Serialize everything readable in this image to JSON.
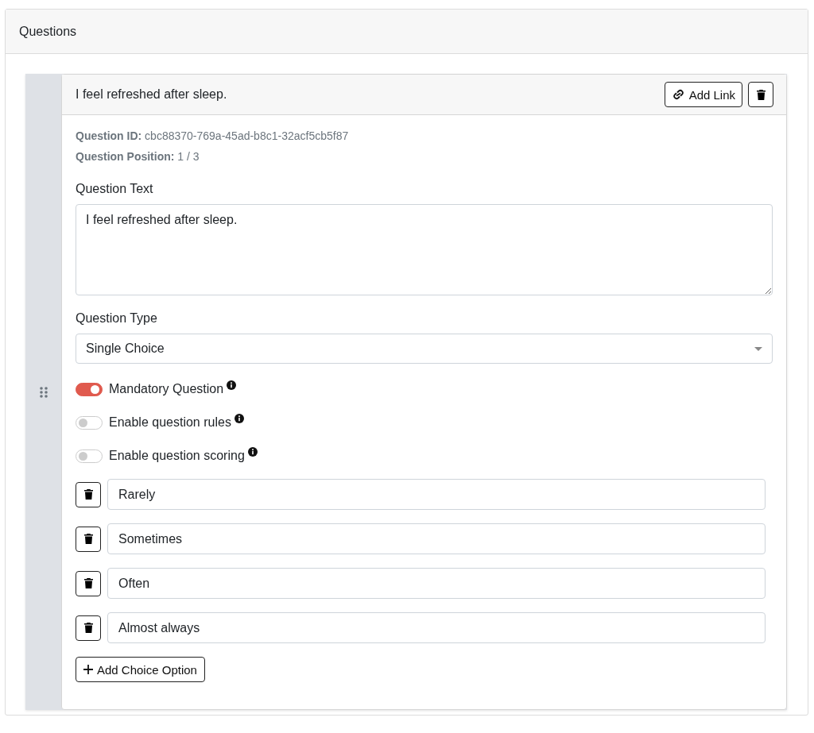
{
  "panel": {
    "title": "Questions"
  },
  "question": {
    "title": "I feel refreshed after sleep.",
    "add_link_button": "Add Link",
    "meta": [
      "**Question ID:** cbc88370-769a-45ad-b8c1-32acf5cb5f87",
      "**Question Position:** 1 / 3"
    ],
    "text_label": "Question Text",
    "text_value": "I feel refreshed after sleep.",
    "type_label": "Question Type",
    "type_value": "Single Choice",
    "toggles": [
      {
        "label": "Mandatory Question",
        "on": true
      },
      {
        "label": "Enable question rules",
        "on": false
      },
      {
        "label": "Enable question scoring",
        "on": false
      }
    ],
    "options": [
      {
        "value": "Rarely"
      },
      {
        "value": "Sometimes"
      },
      {
        "value": "Often"
      },
      {
        "value": "Almost always"
      }
    ],
    "add_option_button": "Add Choice Option"
  }
}
